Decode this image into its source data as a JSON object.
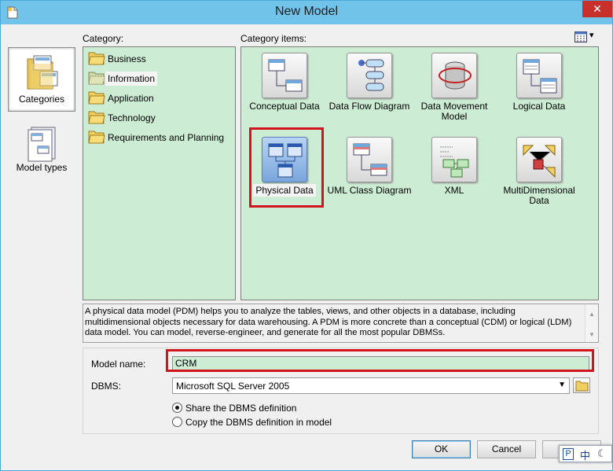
{
  "window": {
    "title": "New Model",
    "close_glyph": "✕",
    "title_icon": "new-document-icon"
  },
  "nav": {
    "items": [
      {
        "label": "Categories",
        "icon": "categories-icon",
        "selected": true
      },
      {
        "label": "Model types",
        "icon": "model-types-icon",
        "selected": false
      }
    ]
  },
  "category": {
    "label": "Category:",
    "items": [
      {
        "label": "Business",
        "selected": false
      },
      {
        "label": "Information",
        "selected": true
      },
      {
        "label": "Application",
        "selected": false
      },
      {
        "label": "Technology",
        "selected": false
      },
      {
        "label": "Requirements and Planning",
        "selected": false
      }
    ]
  },
  "category_items": {
    "label": "Category items:",
    "view_glyph": "▾",
    "items": [
      {
        "label": "Conceptual Data",
        "icon": "conceptual-data-icon"
      },
      {
        "label": "Data Flow Diagram",
        "icon": "data-flow-diagram-icon"
      },
      {
        "label": "Data Movement Model",
        "icon": "data-movement-model-icon"
      },
      {
        "label": "Logical Data",
        "icon": "logical-data-icon"
      },
      {
        "label": "Physical Data",
        "icon": "physical-data-icon",
        "selected": true
      },
      {
        "label": "UML Class Diagram",
        "icon": "uml-class-diagram-icon"
      },
      {
        "label": "XML",
        "icon": "xml-icon"
      },
      {
        "label": "MultiDimensional Data",
        "icon": "multidimensional-data-icon"
      }
    ]
  },
  "description": {
    "text": "A physical data model (PDM) helps you to analyze the tables, views, and other objects in a database, including multidimensional objects necessary for data warehousing. A PDM is more concrete than a conceptual (CDM) or logical (LDM) data model. You can model, reverse-engineer, and generate for all the most popular DBMSs."
  },
  "form": {
    "model_name_label": "Model name:",
    "model_name_value": "CRM",
    "dbms_label": "DBMS:",
    "dbms_value": "Microsoft SQL Server 2005",
    "share_label": "Share the DBMS definition",
    "copy_label": "Copy the DBMS definition in model",
    "share_checked": true
  },
  "buttons": {
    "ok": "OK",
    "cancel": "Cancel"
  },
  "ime": {
    "p": "P",
    "zh": "中",
    "moon": "☾"
  }
}
